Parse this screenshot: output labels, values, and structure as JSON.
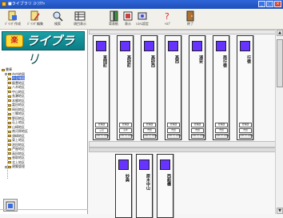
{
  "window": {
    "title": "■ライブラリ ｽﾄﾗｸﾁｬ",
    "min_label": "_",
    "max_label": "□",
    "close_label": "×"
  },
  "toolbar": {
    "buttons": [
      {
        "label": "ﾊﾞｲﾝﾀﾞ作成",
        "icon": "binder-create-icon"
      },
      {
        "label": "ﾊﾞｲﾝﾀﾞ編集",
        "icon": "binder-edit-icon"
      },
      {
        "label": "検索",
        "icon": "search-icon"
      },
      {
        "label": "項目表示",
        "icon": "grid-icon"
      },
      {
        "label": "背表紙",
        "icon": "spine-icon"
      },
      {
        "label": "表示",
        "icon": "view-icon"
      },
      {
        "label": "ｼｽﾃﾑ設定",
        "icon": "settings-icon"
      },
      {
        "label": "ﾍﾙﾌﾟ",
        "icon": "help-icon"
      },
      {
        "label": "終了",
        "icon": "exit-icon"
      }
    ]
  },
  "sidebar": {
    "logo_badge": "楽",
    "logo_text": "ライブラリ",
    "tree": [
      {
        "label": "書庫",
        "indent": 0
      },
      {
        "label": "市内地図",
        "indent": 1,
        "expander": true
      },
      {
        "label": "市全域図",
        "indent": 2,
        "selected": true
      },
      {
        "label": "飯豊地区",
        "indent": 2
      },
      {
        "label": "八木地区",
        "indent": 2
      },
      {
        "label": "中山地区",
        "indent": 2
      },
      {
        "label": "長瀬地区",
        "indent": 2
      },
      {
        "label": "本郷地区",
        "indent": 2
      },
      {
        "label": "富田地区",
        "indent": 2
      },
      {
        "label": "岡田地区",
        "indent": 2
      },
      {
        "label": "三郷地区",
        "indent": 2
      },
      {
        "label": "野田地区",
        "indent": 2
      },
      {
        "label": "石上地区",
        "indent": 2
      },
      {
        "label": "山崎地区",
        "indent": 2
      },
      {
        "label": "南河原地区",
        "indent": 2
      },
      {
        "label": "須崎地区",
        "indent": 2
      },
      {
        "label": "東上地区",
        "indent": 2
      },
      {
        "label": "池田地区",
        "indent": 2
      },
      {
        "label": "芦屋地区",
        "indent": 2
      },
      {
        "label": "高田地区",
        "indent": 2
      },
      {
        "label": "香取地区",
        "indent": 2
      },
      {
        "label": "北上地区",
        "indent": 2
      },
      {
        "label": "建築管理",
        "indent": 1,
        "expander": true
      }
    ]
  },
  "shelves": {
    "top": [
      {
        "title": "東岡町",
        "dept": "管理課",
        "name": "三山",
        "date": "2007/10/02"
      },
      {
        "title": "高砂町",
        "dept": "管理課",
        "name": "高木",
        "date": "2007/10/02"
      },
      {
        "title": "高砂西",
        "dept": "管理課",
        "name": "吉田",
        "date": "2007/10/02"
      },
      {
        "title": "高西",
        "dept": "管理課",
        "name": "吉田",
        "date": "2007/10/02"
      },
      {
        "title": "浦安",
        "dept": "管理課",
        "name": "吉田",
        "date": "2007/10/02"
      },
      {
        "title": "南行徳",
        "dept": "管理課",
        "name": "吉田",
        "date": "2007/10/02"
      },
      {
        "title": "行徳",
        "dept": "管理課",
        "name": "吉田",
        "date": "2007/10/02"
      }
    ],
    "bottom": [
      {
        "title": "妙典"
      },
      {
        "title": "原木中山"
      },
      {
        "title": "西船橋"
      }
    ]
  },
  "colors": {
    "swatch": "#6633ff",
    "titlebar": "#2f66d8"
  }
}
